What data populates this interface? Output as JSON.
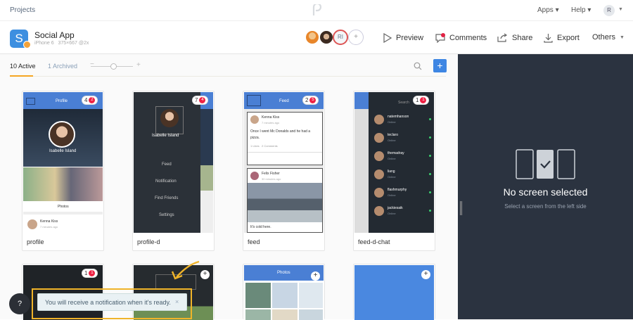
{
  "topbar": {
    "projects": "Projects",
    "apps": "Apps ▾",
    "help": "Help ▾",
    "user_initial": "R"
  },
  "project": {
    "icon_letter": "S",
    "name": "Social App",
    "device": "iPhone 6",
    "size": "375×667 @2x"
  },
  "collaborators": {
    "initials": "RI",
    "add": "+"
  },
  "actions": {
    "preview": "Preview",
    "comments": "Comments",
    "share": "Share",
    "export": "Export",
    "others": "Others"
  },
  "tabs": {
    "active": "10 Active",
    "archived": "1 Archived"
  },
  "zoom": {
    "minus": "−",
    "plus": "+"
  },
  "add_label": "+",
  "screens": [
    {
      "name": "profile",
      "badge_count": "4",
      "badge_alert": "2",
      "header": "Profile",
      "person": "Isabelle Island",
      "section": "Photos",
      "commenter": "Kenna Kiss",
      "comment_time": "7 minutes ago"
    },
    {
      "name": "profile-d",
      "badge_count": "7",
      "badge_alert": "4",
      "person": "Isabelle Island",
      "menu": [
        "Feed",
        "Notification",
        "Find Friends",
        "Settings"
      ]
    },
    {
      "name": "feed",
      "badge_count": "2",
      "badge_alert": "5",
      "header": "Feed",
      "author1": "Kenna Kiss",
      "time1": "7 minutes ago",
      "post1": "Once I went Mc Donalds and he had a pizza.",
      "meta1": "1 Likes   2 Comments",
      "author2": "Felix Fisher",
      "time2": "30 minutes ago",
      "post2": "It's cold here."
    },
    {
      "name": "feed-d-chat",
      "badge_count": "1",
      "badge_alert": "1",
      "search": "Search",
      "contacts": [
        {
          "name": "natemhanson",
          "status": "Online"
        },
        {
          "name": "teclaro",
          "status": "Online"
        },
        {
          "name": "themadray",
          "status": "Online"
        },
        {
          "name": "liang",
          "status": "Online"
        },
        {
          "name": "flashmurphy",
          "status": "Online"
        },
        {
          "name": "jackiesaik",
          "status": "Online"
        }
      ]
    },
    {
      "badge_count": "1",
      "badge_alert": "1"
    },
    {},
    {
      "header": "Photos"
    },
    {}
  ],
  "empty": {
    "title": "No screen selected",
    "subtitle": "Select a screen from the left side"
  },
  "toast": {
    "text": "You will receive a notification when it's ready.",
    "close": "×"
  },
  "help_btn": "?",
  "colors": {
    "accent": "#3e86e3",
    "highlight": "#f5a623",
    "dark_panel": "#2b3340",
    "alert": "#e22244"
  }
}
